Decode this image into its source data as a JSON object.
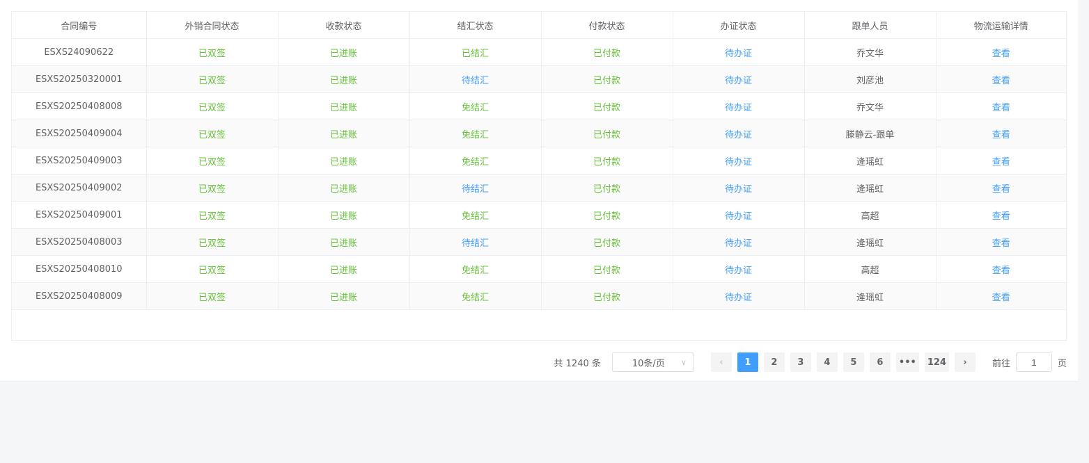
{
  "table": {
    "headers": [
      "合同编号",
      "外销合同状态",
      "收款状态",
      "结汇状态",
      "付款状态",
      "办证状态",
      "跟单人员",
      "物流运输详情"
    ],
    "rows": [
      [
        "ESXS24090622",
        "已双签",
        "已进账",
        "已结汇",
        "已付款",
        "待办证",
        "乔文华",
        "查看"
      ],
      [
        "ESXS20250320001",
        "已双签",
        "已进账",
        "待结汇",
        "已付款",
        "待办证",
        "刘彦池",
        "查看"
      ],
      [
        "ESXS20250408008",
        "已双签",
        "已进账",
        "免结汇",
        "已付款",
        "待办证",
        "乔文华",
        "查看"
      ],
      [
        "ESXS20250409004",
        "已双签",
        "已进账",
        "免结汇",
        "已付款",
        "待办证",
        "滕静云-跟单",
        "查看"
      ],
      [
        "ESXS20250409003",
        "已双签",
        "已进账",
        "免结汇",
        "已付款",
        "待办证",
        "逄瑶虹",
        "查看"
      ],
      [
        "ESXS20250409002",
        "已双签",
        "已进账",
        "待结汇",
        "已付款",
        "待办证",
        "逄瑶虹",
        "查看"
      ],
      [
        "ESXS20250409001",
        "已双签",
        "已进账",
        "免结汇",
        "已付款",
        "待办证",
        "高超",
        "查看"
      ],
      [
        "ESXS20250408003",
        "已双签",
        "已进账",
        "待结汇",
        "已付款",
        "待办证",
        "逄瑶虹",
        "查看"
      ],
      [
        "ESXS20250408010",
        "已双签",
        "已进账",
        "免结汇",
        "已付款",
        "待办证",
        "高超",
        "查看"
      ],
      [
        "ESXS20250408009",
        "已双签",
        "已进账",
        "免结汇",
        "已付款",
        "待办证",
        "逄瑶虹",
        "查看"
      ]
    ],
    "status_colors": {
      "已双签": "#67c23a",
      "已进账": "#67c23a",
      "已结汇": "#67c23a",
      "免结汇": "#67c23a",
      "待结汇": "#409eff",
      "已付款": "#67c23a",
      "待办证": "#409eff"
    }
  },
  "pagination": {
    "total_text": "共 1240 条",
    "page_size": "10条/页",
    "prev_icon": "chevron-left-icon",
    "next_icon": "chevron-right-icon",
    "pages": [
      "1",
      "2",
      "3",
      "4",
      "5",
      "6",
      "•••",
      "124"
    ],
    "current_page": "1",
    "goto_prefix": "前往",
    "goto_value": "1",
    "goto_suffix": "页"
  }
}
